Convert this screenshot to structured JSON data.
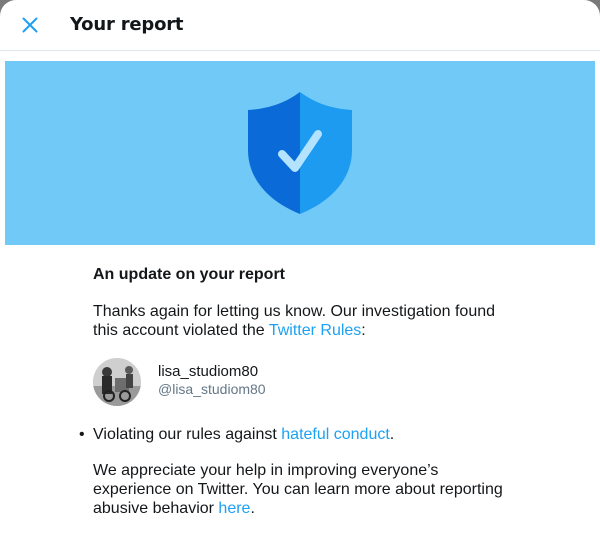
{
  "header": {
    "title": "Your report",
    "close_icon": "close-icon"
  },
  "banner": {
    "icon": "shield-check-icon",
    "colors": {
      "background": "#71c9f8",
      "shield_dark": "#0a6bd8",
      "shield_light": "#1d9bf0"
    }
  },
  "report": {
    "update_title": "An update on your report",
    "para1_text": "Thanks again for letting us know. Our investigation found this account violated the ",
    "rules_link": "Twitter Rules",
    "para1_end": ":",
    "account": {
      "name": "lisa_studiom80",
      "handle": "@lisa_studiom80"
    },
    "violation_text": "Violating our rules against ",
    "violation_link": "hateful conduct",
    "violation_end": ".",
    "para2_text": "We appreciate your help in improving everyone’s experience on Twitter. You can learn more about reporting abusive behavior ",
    "here_link": "here",
    "para2_end": "."
  },
  "accent_color": "#1da1f2"
}
